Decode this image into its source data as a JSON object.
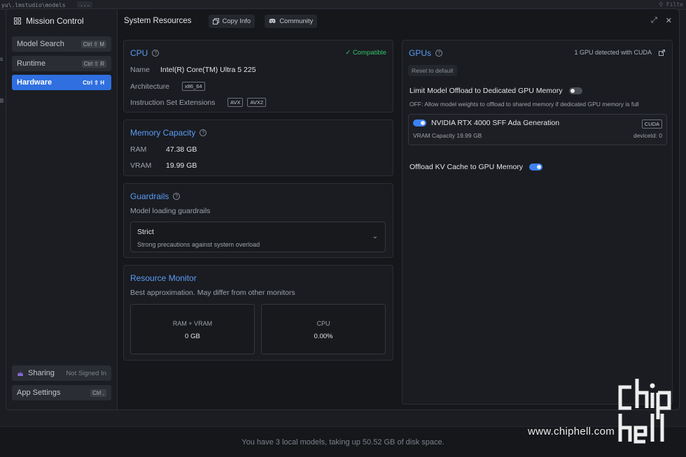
{
  "background": {
    "path_text": "yu\\.lmstudio\\models",
    "dots": "...",
    "search_placeholder": "Filte",
    "left_letters": [
      "s",
      "B"
    ],
    "footer_text": "You have 3 local models, taking up 50.52 GB of disk space."
  },
  "watermark": {
    "url": "www.chiphell.com",
    "logo_text": "chip hell"
  },
  "sidebar": {
    "title": "Mission Control",
    "items": [
      {
        "label": "Model Search",
        "shortcut": "Ctrl ⇧ M"
      },
      {
        "label": "Runtime",
        "shortcut": "Ctrl ⇧ R"
      },
      {
        "label": "Hardware",
        "shortcut": "Ctrl ⇧ H",
        "active": true
      }
    ],
    "bottom": [
      {
        "label": "Sharing",
        "right": "Not Signed In"
      },
      {
        "label": "App Settings",
        "shortcut": "Ctrl ,"
      }
    ]
  },
  "header": {
    "title": "System Resources",
    "copy_info": "Copy Info",
    "community": "Community"
  },
  "cpu": {
    "title": "CPU",
    "status": "✓ Compatible",
    "name_label": "Name",
    "name_value": "Intel(R) Core(TM) Ultra 5 225",
    "arch_label": "Architecture",
    "arch_value": "x86_64",
    "ise_label": "Instruction Set Extensions",
    "ise_values": [
      "AVX",
      "AVX2"
    ]
  },
  "memory": {
    "title": "Memory Capacity",
    "ram_label": "RAM",
    "ram_value": "47.38 GB",
    "vram_label": "VRAM",
    "vram_value": "19.99 GB"
  },
  "guardrails": {
    "title": "Guardrails",
    "subtitle": "Model loading guardrails",
    "selected": "Strict",
    "selected_desc": "Strong precautions against system overload"
  },
  "monitor": {
    "title": "Resource Monitor",
    "subtitle": "Best approximation. May differ from other monitors",
    "ram_vram_label": "RAM + VRAM",
    "ram_vram_value": "0 GB",
    "cpu_label": "CPU",
    "cpu_value": "0.00%"
  },
  "gpus": {
    "title": "GPUs",
    "detected": "1 GPU detected with CUDA",
    "reset": "Reset to default",
    "limit_label": "Limit Model Offload to Dedicated GPU Memory",
    "limit_on": false,
    "limit_note": "OFF: Allow model weights to offload to shared memory if dedicated GPU memory is full",
    "gpu_name": "NVIDIA RTX 4000 SFF Ada Generation",
    "gpu_enabled": true,
    "gpu_badge": "CUDA",
    "gpu_vram": "VRAM Capacity 19.99 GB",
    "gpu_device": "deviceId: 0",
    "kv_label": "Offload KV Cache to GPU Memory",
    "kv_on": true
  }
}
